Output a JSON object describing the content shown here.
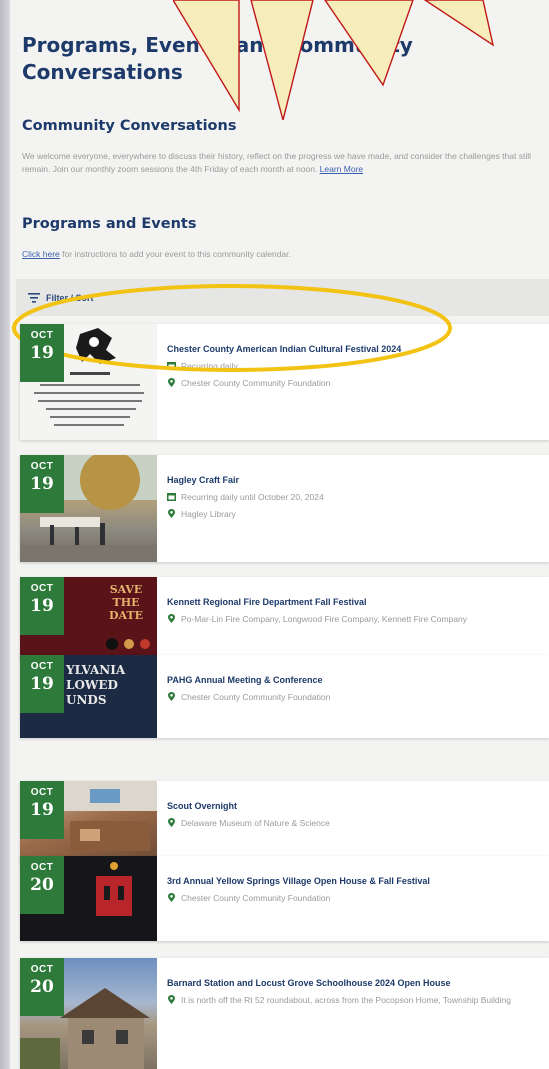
{
  "page": {
    "title": "Programs, Events, and Community Conversations",
    "community_heading": "Community Conversations",
    "community_text": "We welcome everyone, everywhere to discuss their history, reflect on the progress we have made, and consider the challenges that still remain. Join our monthly zoom sessions the 4th Friday of each month at noon.",
    "learn_more": "Learn More",
    "programs_heading": "Programs and Events",
    "click_here": "Click here",
    "instructions_text": " for instructions to add your event to this community calendar."
  },
  "filter": {
    "label": "Filter / Sort"
  },
  "events": [
    {
      "month": "OCT",
      "day": "19",
      "title": "Chester County American Indian Cultural Festival 2024",
      "recurrence": "Recurring daily",
      "location": "Chester County Community Foundation"
    },
    {
      "month": "OCT",
      "day": "19",
      "title": "Hagley Craft Fair",
      "recurrence": "Recurring daily until October 20, 2024",
      "location": "Hagley Library"
    },
    {
      "month": "OCT",
      "day": "19",
      "title": "Kennett Regional Fire Department Fall Festival",
      "location": "Po-Mar-Lin Fire Company, Longwood Fire Company, Kennett Fire Company",
      "thumb_text": [
        "SAVE",
        "THE",
        "DATE"
      ]
    },
    {
      "month": "OCT",
      "day": "19",
      "title": "PAHG Annual Meeting & Conference",
      "location": "Chester County Community Foundation",
      "thumb_text": [
        "YLVANIA",
        "LOWED",
        "UNDS"
      ]
    },
    {
      "month": "OCT",
      "day": "19",
      "title": "Scout Overnight",
      "location": "Delaware Museum of Nature & Science"
    },
    {
      "month": "OCT",
      "day": "20",
      "title": "3rd Annual Yellow Springs Village Open House & Fall Festival",
      "location": "Chester County Community Foundation"
    },
    {
      "month": "OCT",
      "day": "20",
      "title": "Barnard Station and Locust Grove Schoolhouse 2024 Open House",
      "location": "It is north off the Rt 52 roundabout, across from the Pocopson Home, Township Building"
    }
  ],
  "colors": {
    "heading": "#1d3a6b",
    "badge": "#2d7a3a",
    "annotation": "#f2c313"
  }
}
